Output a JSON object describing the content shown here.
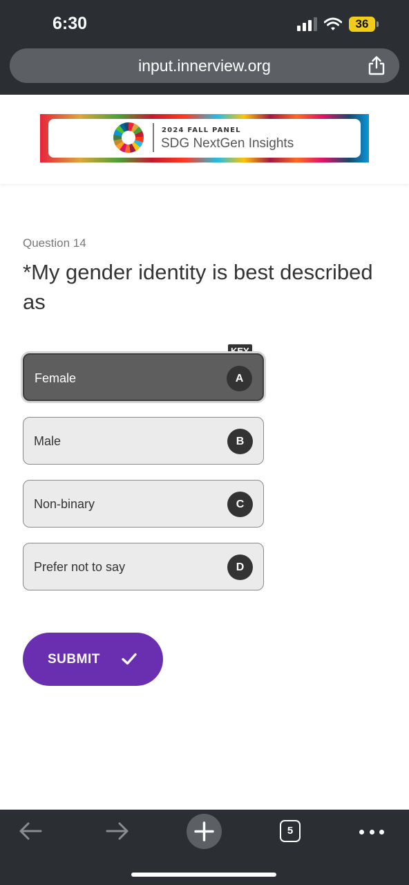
{
  "status_bar": {
    "time": "6:30",
    "battery_level": "36",
    "signal_bars_active": 3,
    "signal_bars_total": 4,
    "wifi_icon": "wifi-icon",
    "battery_color": "#f2cc1a"
  },
  "browser": {
    "url": "input.innerview.org",
    "share_icon": "share-icon",
    "toolbar": {
      "back_icon": "back-arrow-icon",
      "forward_icon": "forward-arrow-icon",
      "new_tab_icon": "plus-icon",
      "tab_count": "5",
      "more_icon": "more-dots-icon"
    }
  },
  "banner": {
    "logo_icon": "sdg-wheel-icon",
    "kicker": "2024 FALL PANEL",
    "title": "SDG NextGen Insights"
  },
  "question": {
    "number_label": "Question 14",
    "text": "*My gender identity is best described as"
  },
  "key_label": "KEY",
  "options": [
    {
      "label": "Female",
      "key": "A",
      "selected": true
    },
    {
      "label": "Male",
      "key": "B",
      "selected": false
    },
    {
      "label": "Non-binary",
      "key": "C",
      "selected": false
    },
    {
      "label": "Prefer not to say",
      "key": "D",
      "selected": false
    }
  ],
  "submit": {
    "label": "SUBMIT",
    "icon": "checkmark-icon",
    "color": "#6a2eb0"
  }
}
